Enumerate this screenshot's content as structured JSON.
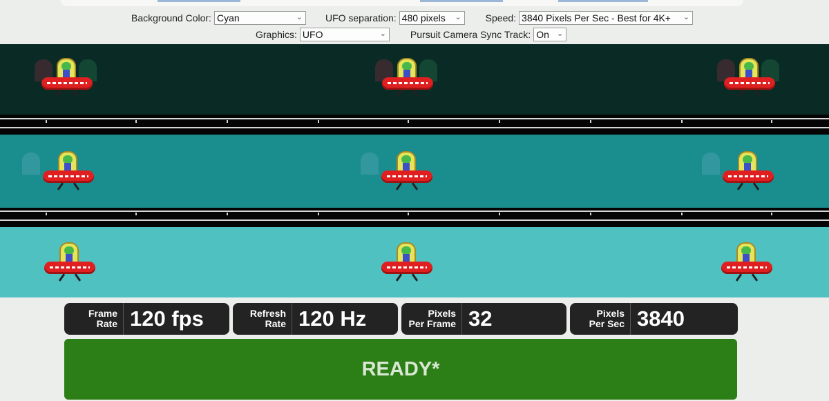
{
  "controls": {
    "background_color": {
      "label": "Background Color:",
      "value": "Cyan"
    },
    "ufo_separation": {
      "label": "UFO separation:",
      "value": "480 pixels"
    },
    "speed": {
      "label": "Speed:",
      "value": "3840 Pixels Per Sec - Best for 4K+"
    },
    "graphics": {
      "label": "Graphics:",
      "value": "UFO"
    },
    "pursuit_camera": {
      "label": "Pursuit Camera Sync Track:",
      "value": "On"
    }
  },
  "lanes": [
    {
      "name": "dark-cyan",
      "color": "#0a2a26"
    },
    {
      "name": "medium-cyan",
      "color": "#1a8e8e"
    },
    {
      "name": "light-cyan",
      "color": "#4ec1c0"
    }
  ],
  "stats": {
    "frame_rate": {
      "label_line1": "Frame",
      "label_line2": "Rate",
      "value": "120 fps"
    },
    "refresh_rate": {
      "label_line1": "Refresh",
      "label_line2": "Rate",
      "value": "120 Hz"
    },
    "pixels_per_frame": {
      "label_line1": "Pixels",
      "label_line2": "Per Frame",
      "value": "32"
    },
    "pixels_per_sec": {
      "label_line1": "Pixels",
      "label_line2": "Per Sec",
      "value": "3840"
    }
  },
  "status": {
    "label": "READY*",
    "color": "#2c7e16"
  },
  "icons": [
    "ufo-icon",
    "chevron-down-icon"
  ]
}
